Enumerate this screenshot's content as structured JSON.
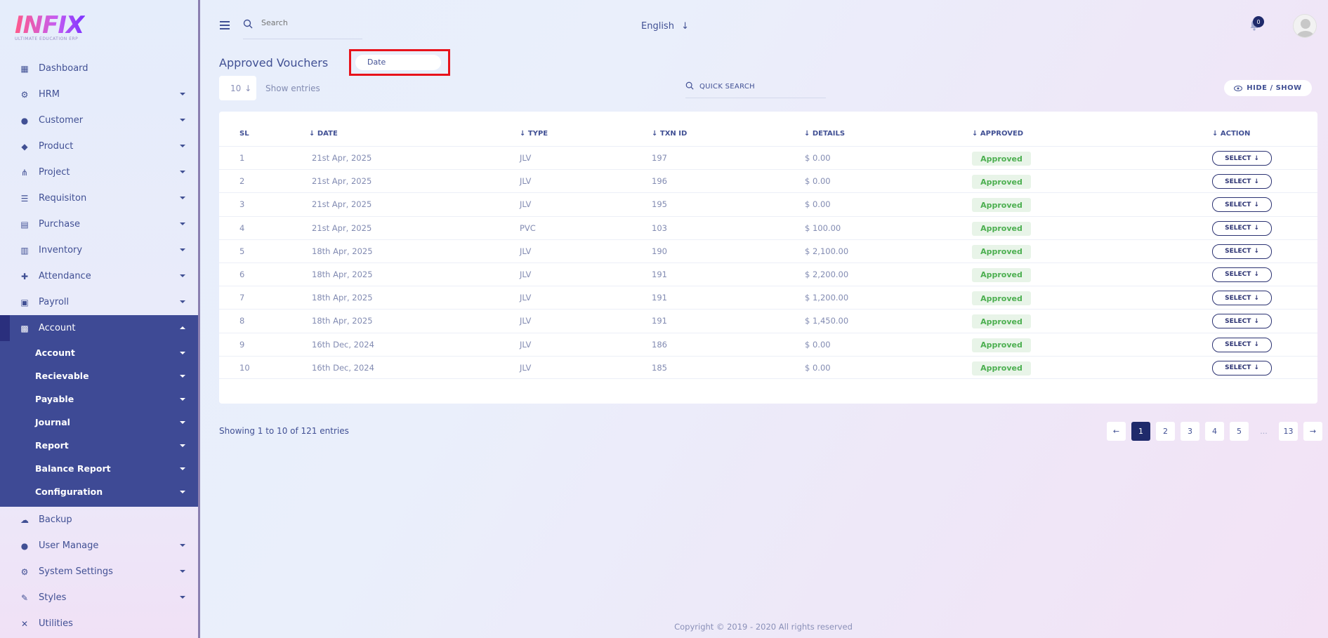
{
  "brand": {
    "logo_text": "INFIX",
    "logo_sub": "ULTIMATE EDUCATION ERP"
  },
  "sidebar": {
    "items": [
      {
        "label": "Dashboard",
        "icon": "grid-icon",
        "has_caret": false
      },
      {
        "label": "HRM",
        "icon": "users-cog-icon",
        "has_caret": true
      },
      {
        "label": "Customer",
        "icon": "user-icon",
        "has_caret": true
      },
      {
        "label": "Product",
        "icon": "tags-icon",
        "has_caret": true
      },
      {
        "label": "Project",
        "icon": "project-diagram-icon",
        "has_caret": true
      },
      {
        "label": "Requisiton",
        "icon": "list-icon",
        "has_caret": true
      },
      {
        "label": "Purchase",
        "icon": "dolly-icon",
        "has_caret": true
      },
      {
        "label": "Inventory",
        "icon": "barcode-icon",
        "has_caret": true
      },
      {
        "label": "Attendance",
        "icon": "user-plus-icon",
        "has_caret": true
      },
      {
        "label": "Payroll",
        "icon": "money-icon",
        "has_caret": true
      },
      {
        "label": "Account",
        "icon": "calculator-icon",
        "has_caret": true,
        "active": true
      }
    ],
    "account_sub": [
      "Account",
      "Recievable",
      "Payable",
      "Journal",
      "Report",
      "Balance Report",
      "Configuration"
    ],
    "after_items": [
      {
        "label": "Backup",
        "icon": "cloud-download-icon",
        "has_caret": false
      },
      {
        "label": "User Manage",
        "icon": "users-icon",
        "has_caret": true
      },
      {
        "label": "System Settings",
        "icon": "cog-icon",
        "has_caret": true
      },
      {
        "label": "Styles",
        "icon": "brush-icon",
        "has_caret": true
      },
      {
        "label": "Utilities",
        "icon": "tools-icon",
        "has_caret": false
      }
    ]
  },
  "header": {
    "search_placeholder": "Search",
    "language": "English",
    "notification_count": "0"
  },
  "page": {
    "title": "Approved Vouchers",
    "date_placeholder": "Date",
    "entries_value": "10",
    "entries_label": "Show entries",
    "quick_search": "QUICK SEARCH",
    "hide_show": "HIDE / SHOW"
  },
  "table": {
    "columns": [
      "SL",
      "DATE",
      "TYPE",
      "TXN ID",
      "DETAILS",
      "APPROVED",
      "ACTION"
    ],
    "rows": [
      {
        "sl": "1",
        "date": "21st Apr, 2025",
        "type": "JLV",
        "txn": "197",
        "details": "$ 0.00",
        "approved": "Approved",
        "action": "SELECT"
      },
      {
        "sl": "2",
        "date": "21st Apr, 2025",
        "type": "JLV",
        "txn": "196",
        "details": "$ 0.00",
        "approved": "Approved",
        "action": "SELECT"
      },
      {
        "sl": "3",
        "date": "21st Apr, 2025",
        "type": "JLV",
        "txn": "195",
        "details": "$ 0.00",
        "approved": "Approved",
        "action": "SELECT"
      },
      {
        "sl": "4",
        "date": "21st Apr, 2025",
        "type": "PVC",
        "txn": "103",
        "details": "$ 100.00",
        "approved": "Approved",
        "action": "SELECT"
      },
      {
        "sl": "5",
        "date": "18th Apr, 2025",
        "type": "JLV",
        "txn": "190",
        "details": "$ 2,100.00",
        "approved": "Approved",
        "action": "SELECT"
      },
      {
        "sl": "6",
        "date": "18th Apr, 2025",
        "type": "JLV",
        "txn": "191",
        "details": "$ 2,200.00",
        "approved": "Approved",
        "action": "SELECT"
      },
      {
        "sl": "7",
        "date": "18th Apr, 2025",
        "type": "JLV",
        "txn": "191",
        "details": "$ 1,200.00",
        "approved": "Approved",
        "action": "SELECT"
      },
      {
        "sl": "8",
        "date": "18th Apr, 2025",
        "type": "JLV",
        "txn": "191",
        "details": "$ 1,450.00",
        "approved": "Approved",
        "action": "SELECT"
      },
      {
        "sl": "9",
        "date": "16th Dec, 2024",
        "type": "JLV",
        "txn": "186",
        "details": "$ 0.00",
        "approved": "Approved",
        "action": "SELECT"
      },
      {
        "sl": "10",
        "date": "16th Dec, 2024",
        "type": "JLV",
        "txn": "185",
        "details": "$ 0.00",
        "approved": "Approved",
        "action": "SELECT"
      }
    ]
  },
  "pagination": {
    "showing": "Showing 1 to 10 of 121 entries",
    "pages": [
      "1",
      "2",
      "3",
      "4",
      "5",
      "...",
      "13"
    ],
    "current": "1"
  },
  "footer": {
    "copyright": "Copyright © 2019 - 2020 All rights reserved"
  },
  "colors": {
    "primary": "#415094",
    "active_bg": "#3e4a95",
    "approved_green": "#4caf50",
    "highlight_red": "#e8131b"
  }
}
